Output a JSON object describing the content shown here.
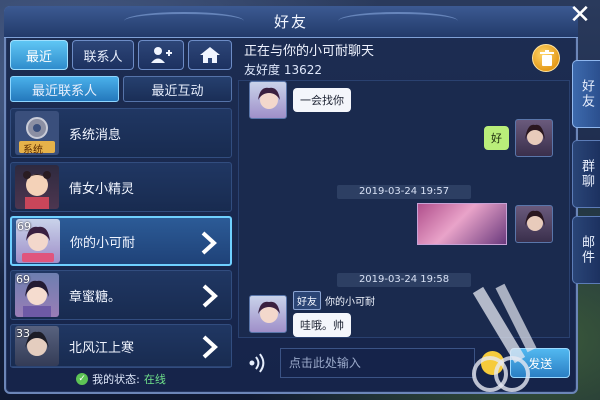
{
  "window": {
    "title": "好友",
    "close_icon": "close-icon"
  },
  "tabs": {
    "recent_label": "最近",
    "contacts_label": "联系人",
    "add_friend_icon": "add-friend-icon",
    "home_icon": "home-icon"
  },
  "sub_tabs": {
    "recent_contacts": "最近联系人",
    "recent_interactions": "最近互动"
  },
  "contacts": [
    {
      "name": "系统消息",
      "level": "",
      "badge": "系统",
      "selected": false,
      "arrow": false
    },
    {
      "name": "倩女小精灵",
      "level": "",
      "selected": false,
      "arrow": false
    },
    {
      "name": "你的小可耐",
      "level": "69",
      "selected": true,
      "arrow": true
    },
    {
      "name": "章蜜糖。",
      "level": "69",
      "selected": false,
      "arrow": true
    },
    {
      "name": "北风江上寒",
      "level": "33",
      "selected": false,
      "arrow": true
    }
  ],
  "status": {
    "label": "我的状态:",
    "value": "在线"
  },
  "chat": {
    "header_line1": "正在与你的小可耐聊天",
    "friendship_label": "友好度",
    "friendship_value": "13622",
    "messages": [
      {
        "text": "一会找你"
      },
      {
        "text": "好"
      },
      {
        "timestamp": "2019-03-24 19:57"
      },
      {
        "image": "screenshot-image"
      },
      {
        "timestamp": "2019-03-24 19:58"
      },
      {
        "sender_tag": "好友",
        "sender_name": "你的小可耐",
        "text": "哇哦。帅"
      }
    ],
    "input_placeholder": "点击此处输入",
    "send_label": "发送"
  },
  "side_tabs": [
    {
      "label": "好友",
      "active": true
    },
    {
      "label": "群聊",
      "active": false
    },
    {
      "label": "邮件",
      "active": false
    }
  ],
  "colors": {
    "accent": "#4ab0ea",
    "online": "#6ee08a",
    "bubble_green": "#b9ee7a"
  }
}
